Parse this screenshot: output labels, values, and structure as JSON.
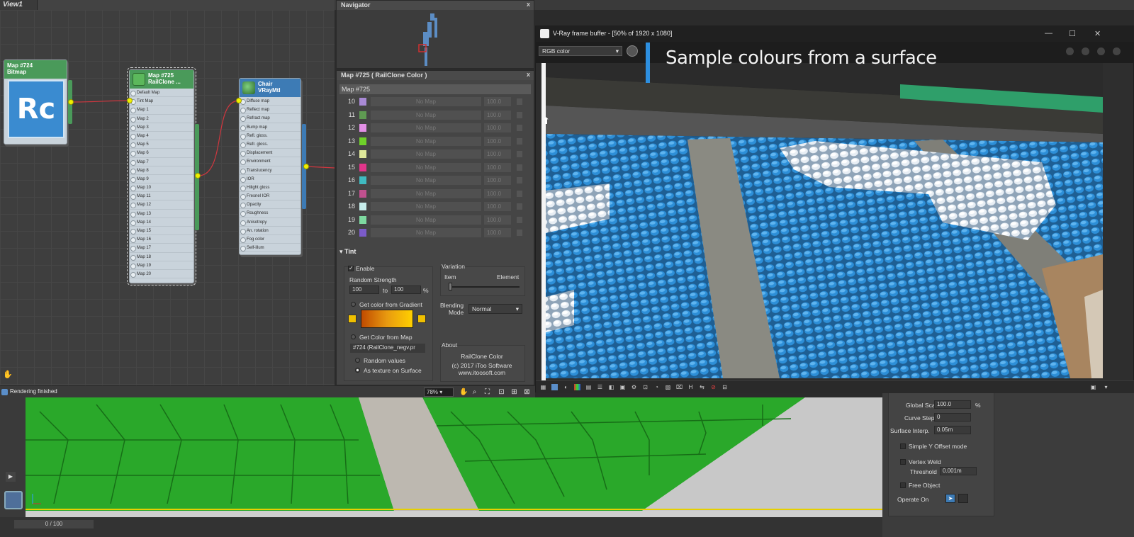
{
  "top": {
    "view_title": "View1"
  },
  "slate": {
    "nodes": {
      "bitmap": {
        "title": "Map #724",
        "subtitle": "Bitmap",
        "logo_text": "Rc"
      },
      "railclone": {
        "title": "Map #725",
        "subtitle": "RailClone ...",
        "slots": [
          "Default Map",
          "Tint Map",
          "Map 1",
          "Map 2",
          "Map 3",
          "Map 4",
          "Map 5",
          "Map 6",
          "Map 7",
          "Map 8",
          "Map 9",
          "Map 10",
          "Map 11",
          "Map 12",
          "Map 13",
          "Map 14",
          "Map 15",
          "Map 16",
          "Map 17",
          "Map 18",
          "Map 19",
          "Map 20"
        ]
      },
      "vray": {
        "title": "Chair",
        "subtitle": "VRayMtl",
        "slots": [
          "Diffuse map",
          "Reflect map",
          "Refract map",
          "Bump map",
          "Refl. gloss.",
          "Refr. gloss.",
          "Displacement",
          "Environment",
          "Translucency",
          "IOR",
          "Hilight gloss",
          "Fresnel IOR",
          "Opacity",
          "Roughness",
          "Anisotropy",
          "An. rotation",
          "Fog color",
          "Self-illum"
        ]
      }
    }
  },
  "status": {
    "text": "Rendering finished",
    "zoom": "78%"
  },
  "navigator": {
    "title": "Navigator",
    "close": "x"
  },
  "params": {
    "title": "Map #725  ( RailClone Color )",
    "close": "x",
    "map_name": "Map #725",
    "rows": [
      {
        "num": "10",
        "color": "#a98ad6",
        "slot": "No Map",
        "value": "100.0"
      },
      {
        "num": "11",
        "color": "#5f9a52",
        "slot": "No Map",
        "value": "100.0"
      },
      {
        "num": "12",
        "color": "#e390e6",
        "slot": "No Map",
        "value": "100.0"
      },
      {
        "num": "13",
        "color": "#6fd12a",
        "slot": "No Map",
        "value": "100.0"
      },
      {
        "num": "14",
        "color": "#dfe89a",
        "slot": "No Map",
        "value": "100.0"
      },
      {
        "num": "15",
        "color": "#e0358a",
        "slot": "No Map",
        "value": "100.0"
      },
      {
        "num": "16",
        "color": "#3fbac0",
        "slot": "No Map",
        "value": "100.0"
      },
      {
        "num": "17",
        "color": "#c0508e",
        "slot": "No Map",
        "value": "100.0"
      },
      {
        "num": "18",
        "color": "#c6ecea",
        "slot": "No Map",
        "value": "100.0"
      },
      {
        "num": "19",
        "color": "#7ed9a0",
        "slot": "No Map",
        "value": "100.0"
      },
      {
        "num": "20",
        "color": "#7b5bc9",
        "slot": "No Map",
        "value": "100.0"
      }
    ],
    "tint": {
      "header": "Tint",
      "enable_label": "Enable",
      "enable_checked": true,
      "random_strength_label": "Random Strength",
      "strength_from": "100",
      "to_label": "to",
      "strength_to": "100",
      "percent": "%",
      "gradient_label": "Get color from Gradient",
      "map_label": "Get Color from Map",
      "map_button": "#724 (RailClone_negv.pr",
      "random_values_label": "Random values",
      "texture_surface_label": "As texture on Surface",
      "selected_mode": "As texture on Surface",
      "variation_label": "Variation",
      "item_label": "Item",
      "element_label": "Element",
      "variation_level": 0,
      "blending_label_1": "Blending",
      "blending_label_2": "Mode",
      "blending_value": "Normal",
      "about_label": "About",
      "about_line1": "RailClone Color",
      "about_line2": "(c) 2017 iToo Software",
      "about_line3": "www.itoosoft.com"
    }
  },
  "vfb": {
    "title": "V-Ray frame buffer - [50% of 1920 x 1080]",
    "channel": "RGB color",
    "caption": "Sample colours from a surface",
    "btn_min": "—",
    "btn_max": "☐",
    "btn_close": "✕"
  },
  "command_panel": {
    "global_scale_label": "Global Scale",
    "global_scale_value": "100.0",
    "global_scale_unit": "%",
    "curve_steps_label": "Curve Steps",
    "curve_steps_value": "0",
    "surface_interp_label": "Surface Interp.",
    "surface_interp_value": "0.05m",
    "simple_y_label": "Simple Y Offset mode",
    "vertex_weld_label": "Vertex Weld",
    "threshold_label": "Threshold",
    "threshold_value": "0.001m",
    "free_object_label": "Free Object",
    "operate_on_label": "Operate On"
  },
  "timeline": {
    "frame_counter": "0 / 100"
  },
  "colors": {
    "accent_blue": "#2d8fe0",
    "wire_red": "#d0373f",
    "pin_yellow": "#f0f000",
    "viewport_highlight": "#e6d000"
  }
}
